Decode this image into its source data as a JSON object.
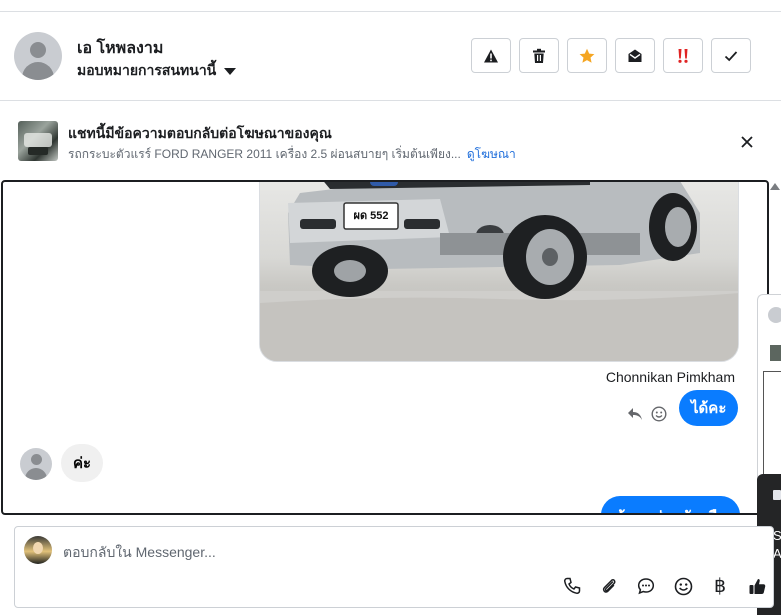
{
  "header": {
    "contact_name": "เอ โหพลงาม",
    "assign_label": "มอบหมายการสนทนานี้",
    "actions": [
      {
        "name": "report-button",
        "icon": "warning-icon",
        "color": "#1c1e21"
      },
      {
        "name": "delete-button",
        "icon": "trash-icon",
        "color": "#1c1e21"
      },
      {
        "name": "star-button",
        "icon": "star-icon",
        "color": "#f5a623"
      },
      {
        "name": "mark-unread-button",
        "icon": "envelope-open-icon",
        "color": "#1c1e21"
      },
      {
        "name": "follow-up-button",
        "icon": "double-exclamation-icon",
        "color": "#e02424"
      },
      {
        "name": "mark-done-button",
        "icon": "check-icon",
        "color": "#1c1e21"
      }
    ]
  },
  "banner": {
    "title": "แชทนี้มีข้อความตอบกลับต่อโฆษณาของคุณ",
    "subtitle": "รถกระบะตัวแรร์ FORD RANGER 2011 เครื่อง 2.5 ผ่อนสบายๆ เริ่มต้นเพียง...",
    "link": "ดูโฆษณา"
  },
  "conversation": {
    "photo_plate": "ผด 552",
    "sender_name": "Chonnikan Pimkham",
    "messages": [
      {
        "direction": "out",
        "text": "ได้คะ"
      },
      {
        "direction": "in",
        "text": "ค่ะ"
      },
      {
        "direction": "out",
        "text": "ข้อมูลส่วนตัวหรือ"
      }
    ]
  },
  "side_toast": {
    "line1": "S",
    "line2": "A"
  },
  "composer": {
    "placeholder": "ตอบกลับใน Messenger...",
    "tools": [
      {
        "name": "call-button",
        "icon": "phone-icon"
      },
      {
        "name": "attach-button",
        "icon": "paperclip-icon"
      },
      {
        "name": "saved-reply-button",
        "icon": "chat-bubble-icon"
      },
      {
        "name": "emoji-button",
        "icon": "smile-icon"
      },
      {
        "name": "payment-button",
        "icon": "baht-icon",
        "glyph": "฿"
      },
      {
        "name": "like-button",
        "icon": "thumbs-up-icon"
      }
    ]
  },
  "colors": {
    "accent": "#0a7cff",
    "link": "#216fdb",
    "star": "#f5a623",
    "alert": "#e02424"
  }
}
